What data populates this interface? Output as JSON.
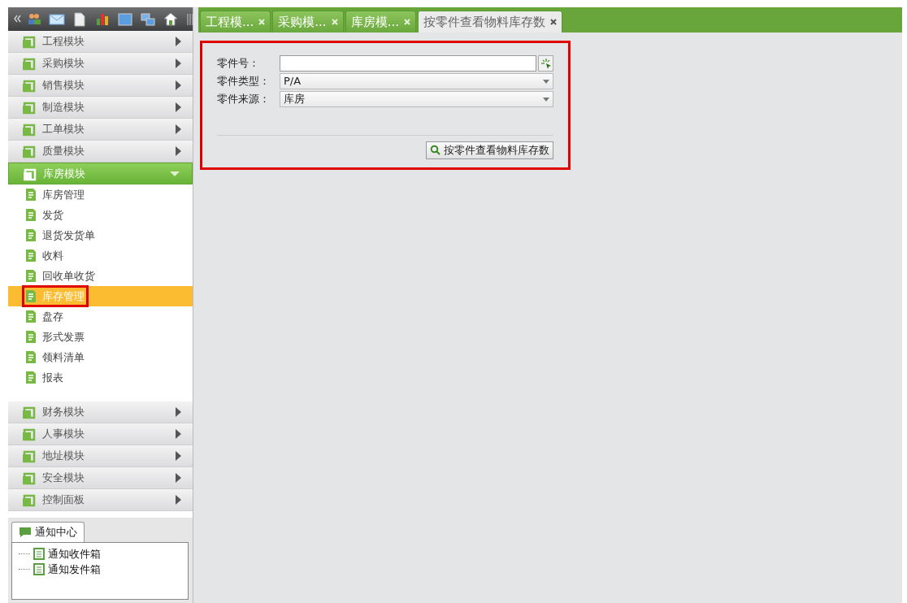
{
  "sidebar": {
    "modules": [
      {
        "label": "工程模块",
        "expanded": false
      },
      {
        "label": "采购模块",
        "expanded": false
      },
      {
        "label": "销售模块",
        "expanded": false
      },
      {
        "label": "制造模块",
        "expanded": false
      },
      {
        "label": "工单模块",
        "expanded": false
      },
      {
        "label": "质量模块",
        "expanded": false
      },
      {
        "label": "库房模块",
        "expanded": true,
        "children": [
          {
            "label": "库房管理",
            "selected": false,
            "highlighted": false
          },
          {
            "label": "发货",
            "selected": false,
            "highlighted": false
          },
          {
            "label": "退货发货单",
            "selected": false,
            "highlighted": false
          },
          {
            "label": "收料",
            "selected": false,
            "highlighted": false
          },
          {
            "label": "回收单收货",
            "selected": false,
            "highlighted": false
          },
          {
            "label": "库存管理",
            "selected": true,
            "highlighted": true
          },
          {
            "label": "盘存",
            "selected": false,
            "highlighted": false
          },
          {
            "label": "形式发票",
            "selected": false,
            "highlighted": false
          },
          {
            "label": "领料清单",
            "selected": false,
            "highlighted": false
          },
          {
            "label": "报表",
            "selected": false,
            "highlighted": false
          }
        ]
      },
      {
        "label": "财务模块",
        "expanded": false
      },
      {
        "label": "人事模块",
        "expanded": false
      },
      {
        "label": "地址模块",
        "expanded": false
      },
      {
        "label": "安全模块",
        "expanded": false
      },
      {
        "label": "控制面板",
        "expanded": false
      }
    ]
  },
  "notifications": {
    "tab": "通知中心",
    "items": [
      "通知收件箱",
      "通知发件箱"
    ]
  },
  "tabs": [
    {
      "label": "工程模...",
      "selected": false
    },
    {
      "label": "采购模...",
      "selected": false
    },
    {
      "label": "库房模...",
      "selected": false
    },
    {
      "label": "按零件查看物料库存数",
      "selected": true
    }
  ],
  "form": {
    "highlighted": true,
    "fields": [
      {
        "kind": "input",
        "label": "零件号："
      },
      {
        "kind": "select",
        "label": "零件类型：",
        "value": "P/A"
      },
      {
        "kind": "select",
        "label": "零件来源：",
        "value": "库房"
      }
    ],
    "button": "按零件查看物料库存数"
  }
}
